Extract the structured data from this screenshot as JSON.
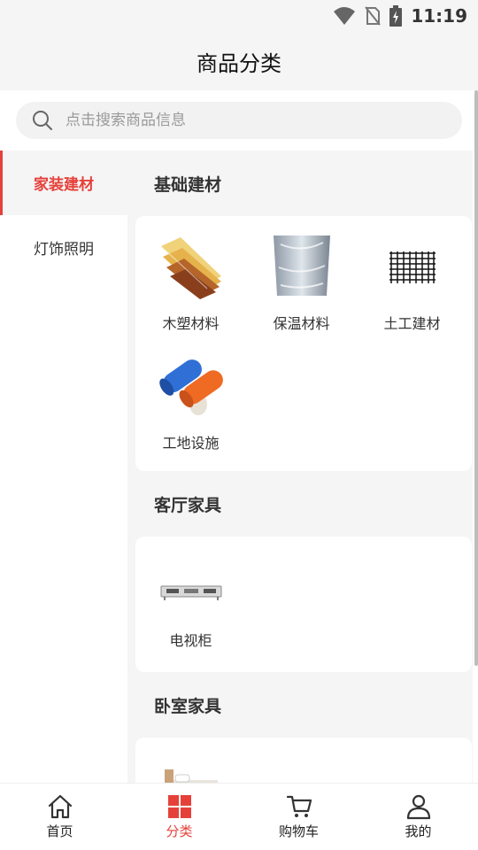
{
  "status": {
    "time": "11:19"
  },
  "header": {
    "title": "商品分类"
  },
  "search": {
    "placeholder": "点击搜索商品信息"
  },
  "sidebar": {
    "items": [
      {
        "label": "家装建材"
      },
      {
        "label": "灯饰照明"
      }
    ]
  },
  "sections": [
    {
      "title": "基础建材",
      "items": [
        {
          "label": "木塑材料"
        },
        {
          "label": "保温材料"
        },
        {
          "label": "土工建材"
        },
        {
          "label": "工地设施"
        }
      ]
    },
    {
      "title": "客厅家具",
      "items": [
        {
          "label": "电视柜"
        }
      ]
    },
    {
      "title": "卧室家具",
      "items": []
    }
  ],
  "tabbar": {
    "items": [
      {
        "label": "首页"
      },
      {
        "label": "分类"
      },
      {
        "label": "购物车"
      },
      {
        "label": "我的"
      }
    ]
  },
  "colors": {
    "accent": "#e5413a",
    "background": "#f5f5f5",
    "card": "#ffffff"
  }
}
